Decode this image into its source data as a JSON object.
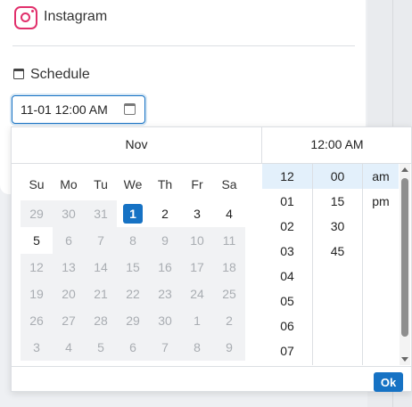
{
  "card": {
    "platform_label": "Instagram",
    "icon": "instagram-icon",
    "schedule_label": "Schedule",
    "schedule_icon": "calendar-icon"
  },
  "date_input": {
    "value": "11-01 12:00 AM",
    "icon": "calendar-icon",
    "focus_color": "#1672c4"
  },
  "picker": {
    "month_label": "Nov",
    "time_label": "12:00 AM",
    "weekdays": [
      "Su",
      "Mo",
      "Tu",
      "We",
      "Th",
      "Fr",
      "Sa"
    ],
    "weeks": [
      [
        "29",
        "30",
        "31",
        "1",
        "2",
        "3",
        "4"
      ],
      [
        "5",
        "6",
        "7",
        "8",
        "9",
        "10",
        "11"
      ],
      [
        "12",
        "13",
        "14",
        "15",
        "16",
        "17",
        "18"
      ],
      [
        "19",
        "20",
        "21",
        "22",
        "23",
        "24",
        "25"
      ],
      [
        "26",
        "27",
        "28",
        "29",
        "30",
        "1",
        "2"
      ],
      [
        "3",
        "4",
        "5",
        "6",
        "7",
        "8",
        "9"
      ]
    ],
    "selected_day": "1",
    "hours": [
      "12",
      "01",
      "02",
      "03",
      "04",
      "05",
      "06",
      "07"
    ],
    "minutes": [
      "00",
      "15",
      "30",
      "45"
    ],
    "ampm": [
      "am",
      "pm"
    ],
    "selected_hour": "12",
    "selected_minute": "00",
    "selected_ampm": "am",
    "ok_label": "Ok"
  },
  "colors": {
    "accent": "#1672c4",
    "instagram": "#e1306c",
    "selected_time_bg": "#e3f0fb"
  }
}
